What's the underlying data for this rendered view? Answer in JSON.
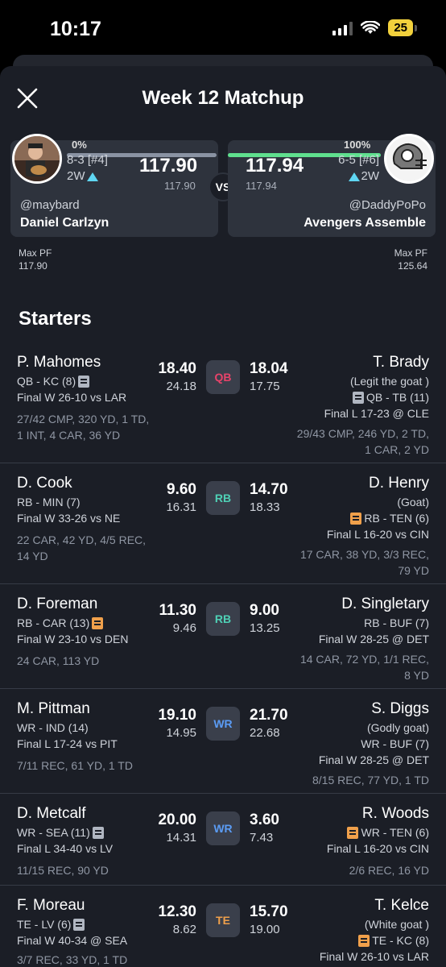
{
  "status": {
    "time": "10:17",
    "battery": "25"
  },
  "header": {
    "title": "Week 12 Matchup"
  },
  "colors": {
    "bg": "#1b1e26",
    "card": "#2e333d",
    "win_bar": "#5fe08e",
    "lose_bar": "#8a93a3",
    "qb": "#e8436a",
    "rb": "#4fd1b6",
    "wr": "#5b9cf5",
    "te": "#f0a04b"
  },
  "team_left": {
    "pct": "0%",
    "record": "8-3 [#4]",
    "streak": "2W",
    "score": "117.90",
    "projected": "117.90",
    "handle": "@maybard",
    "name": "Daniel Carlzyn",
    "max_pf_label": "Max PF",
    "max_pf": "117.90",
    "win_fraction": 0.0
  },
  "team_right": {
    "pct": "100%",
    "record": "6-5 [#6]",
    "streak": "2W",
    "score": "117.94",
    "projected": "117.94",
    "handle": "@DaddyPoPo",
    "name": "Avengers Assemble",
    "max_pf_label": "Max PF",
    "max_pf": "125.64",
    "win_fraction": 1.0
  },
  "vs": "VS",
  "section": {
    "title": "Starters"
  },
  "rows": [
    {
      "pos": "QB",
      "left": {
        "name": "P. Mahomes",
        "meta1": "QB - KC (8)",
        "meta2": "Final W 26-10 vs LAR",
        "stats1": "27/42 CMP, 320 YD, 1 TD,",
        "stats2": "1 INT, 4 CAR, 36 YD",
        "score": "18.40",
        "proj": "24.18"
      },
      "right": {
        "name": "T. Brady",
        "nick": "(Legit the goat )",
        "meta1": "QB - TB (11)",
        "meta2": "Final L 17-23 @ CLE",
        "stats1": "29/43 CMP, 246 YD, 2 TD,",
        "stats2": "1 CAR, 2 YD",
        "score": "18.04",
        "proj": "17.75"
      }
    },
    {
      "pos": "RB",
      "left": {
        "name": "D. Cook",
        "meta1": "RB - MIN (7)",
        "meta2": "Final W 33-26 vs NE",
        "stats1": "22 CAR, 42 YD, 4/5 REC,",
        "stats2": "14 YD",
        "score": "9.60",
        "proj": "16.31"
      },
      "right": {
        "name": "D. Henry",
        "nick": "(Goat)",
        "meta1": "RB - TEN (6)",
        "meta2": "Final L 16-20 vs CIN",
        "stats1": "17 CAR, 38 YD, 3/3 REC,",
        "stats2": "79 YD",
        "score": "14.70",
        "proj": "18.33"
      }
    },
    {
      "pos": "RB",
      "left": {
        "name": "D. Foreman",
        "meta1": "RB - CAR (13)",
        "meta2": "Final W 23-10 vs DEN",
        "stats1": "24 CAR, 113 YD",
        "stats2": "",
        "score": "11.30",
        "proj": "9.46"
      },
      "right": {
        "name": "D. Singletary",
        "nick": "",
        "meta1": "RB - BUF (7)",
        "meta2": "Final W 28-25 @ DET",
        "stats1": "14 CAR, 72 YD, 1/1 REC,",
        "stats2": "8 YD",
        "score": "9.00",
        "proj": "13.25"
      }
    },
    {
      "pos": "WR",
      "left": {
        "name": "M. Pittman",
        "meta1": "WR - IND (14)",
        "meta2": "Final L 17-24 vs PIT",
        "stats1": "7/11 REC, 61 YD, 1 TD",
        "stats2": "",
        "score": "19.10",
        "proj": "14.95"
      },
      "right": {
        "name": "S. Diggs",
        "nick": "(Godly goat)",
        "meta1": "WR - BUF (7)",
        "meta2": "Final W 28-25 @ DET",
        "stats1": "8/15 REC, 77 YD, 1 TD",
        "stats2": "",
        "score": "21.70",
        "proj": "22.68"
      }
    },
    {
      "pos": "WR",
      "left": {
        "name": "D. Metcalf",
        "meta1": "WR - SEA (11)",
        "meta2": "Final L 34-40 vs LV",
        "stats1": "11/15 REC, 90 YD",
        "stats2": "",
        "score": "20.00",
        "proj": "14.31"
      },
      "right": {
        "name": "R. Woods",
        "nick": "",
        "meta1": "WR - TEN (6)",
        "meta2": "Final L 16-20 vs CIN",
        "stats1": "2/6 REC, 16 YD",
        "stats2": "",
        "score": "3.60",
        "proj": "7.43"
      }
    },
    {
      "pos": "TE",
      "left": {
        "name": "F. Moreau",
        "meta1": "TE - LV (6)",
        "meta2": "Final W 40-34 @ SEA",
        "stats1": "3/7 REC, 33 YD, 1 TD",
        "stats2": "",
        "score": "12.30",
        "proj": "8.62"
      },
      "right": {
        "name": "T. Kelce",
        "nick": "(White goat )",
        "meta1": "TE - KC (8)",
        "meta2": "Final W 26-10 vs LAR",
        "stats1": "",
        "stats2": "",
        "score": "15.70",
        "proj": "19.00"
      }
    }
  ]
}
